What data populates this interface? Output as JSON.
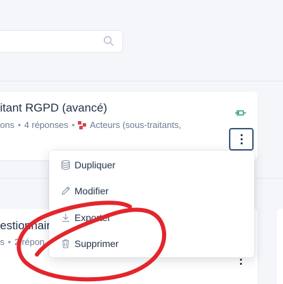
{
  "search": {
    "placeholder": ""
  },
  "cards": [
    {
      "title": "itant RGPD (avancé)",
      "meta_prefix": "ons",
      "responses": "4 réponses",
      "actors": "Acteurs (sous-traitants,"
    },
    {
      "title": "estionnair",
      "meta_prefix": "s",
      "responses": "2 répon"
    }
  ],
  "menu": {
    "items": [
      {
        "label": "Dupliquer",
        "icon": "database-icon"
      },
      {
        "label": "Modifier",
        "icon": "pencil-icon"
      },
      {
        "label": "Exporter",
        "icon": "download-icon"
      },
      {
        "label": "Supprimer",
        "icon": "trash-icon"
      }
    ]
  },
  "colors": {
    "text_primary": "#23324a",
    "text_secondary": "#6c7c93",
    "pin_green": "#2fa66a",
    "actors_red": "#d64545",
    "focus_border": "#33557a",
    "annotation_red": "#e2262c"
  }
}
